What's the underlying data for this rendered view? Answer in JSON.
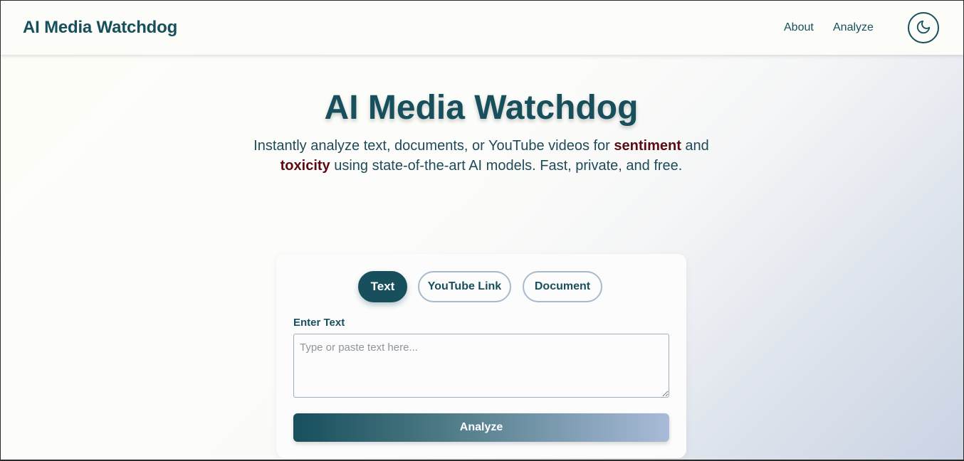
{
  "header": {
    "brand": "AI Media Watchdog",
    "nav": [
      {
        "label": "About"
      },
      {
        "label": "Analyze"
      }
    ],
    "theme_toggle_icon": "moon-icon"
  },
  "hero": {
    "title": "AI Media Watchdog",
    "subtitle_part1": "Instantly analyze text, documents, or YouTube videos for ",
    "subtitle_bold1": "sentiment",
    "subtitle_part2": " and ",
    "subtitle_bold2": "toxicity",
    "subtitle_part3": " using state-of-the-art AI models. Fast, private, and free."
  },
  "card": {
    "tabs": [
      {
        "label": "Text",
        "active": true
      },
      {
        "label": "YouTube Link",
        "active": false
      },
      {
        "label": "Document",
        "active": false
      }
    ],
    "field_label": "Enter Text",
    "placeholder": "Type or paste text here...",
    "value": "",
    "submit_label": "Analyze"
  },
  "colors": {
    "primary": "#174f5c",
    "emphasis": "#5b0b12",
    "border": "#a8b9cc"
  }
}
